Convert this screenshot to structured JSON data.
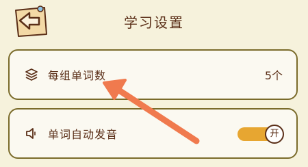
{
  "header": {
    "title": "学习设置",
    "back_icon": "back-arrow-note-icon"
  },
  "settings": {
    "words_per_group": {
      "icon": "layers-icon",
      "label": "每组单词数",
      "value": "5个"
    },
    "auto_pronounce": {
      "icon": "speaker-icon",
      "label": "单词自动发音",
      "toggle_text": "开",
      "enabled": true
    }
  },
  "colors": {
    "background": "#f6f2dc",
    "text": "#5a2e17",
    "card_border": "#7a6b2a",
    "card_fill": "#fbf9f1",
    "toggle_on": "#e7a631",
    "annotation_arrow": "#f07a4e"
  }
}
